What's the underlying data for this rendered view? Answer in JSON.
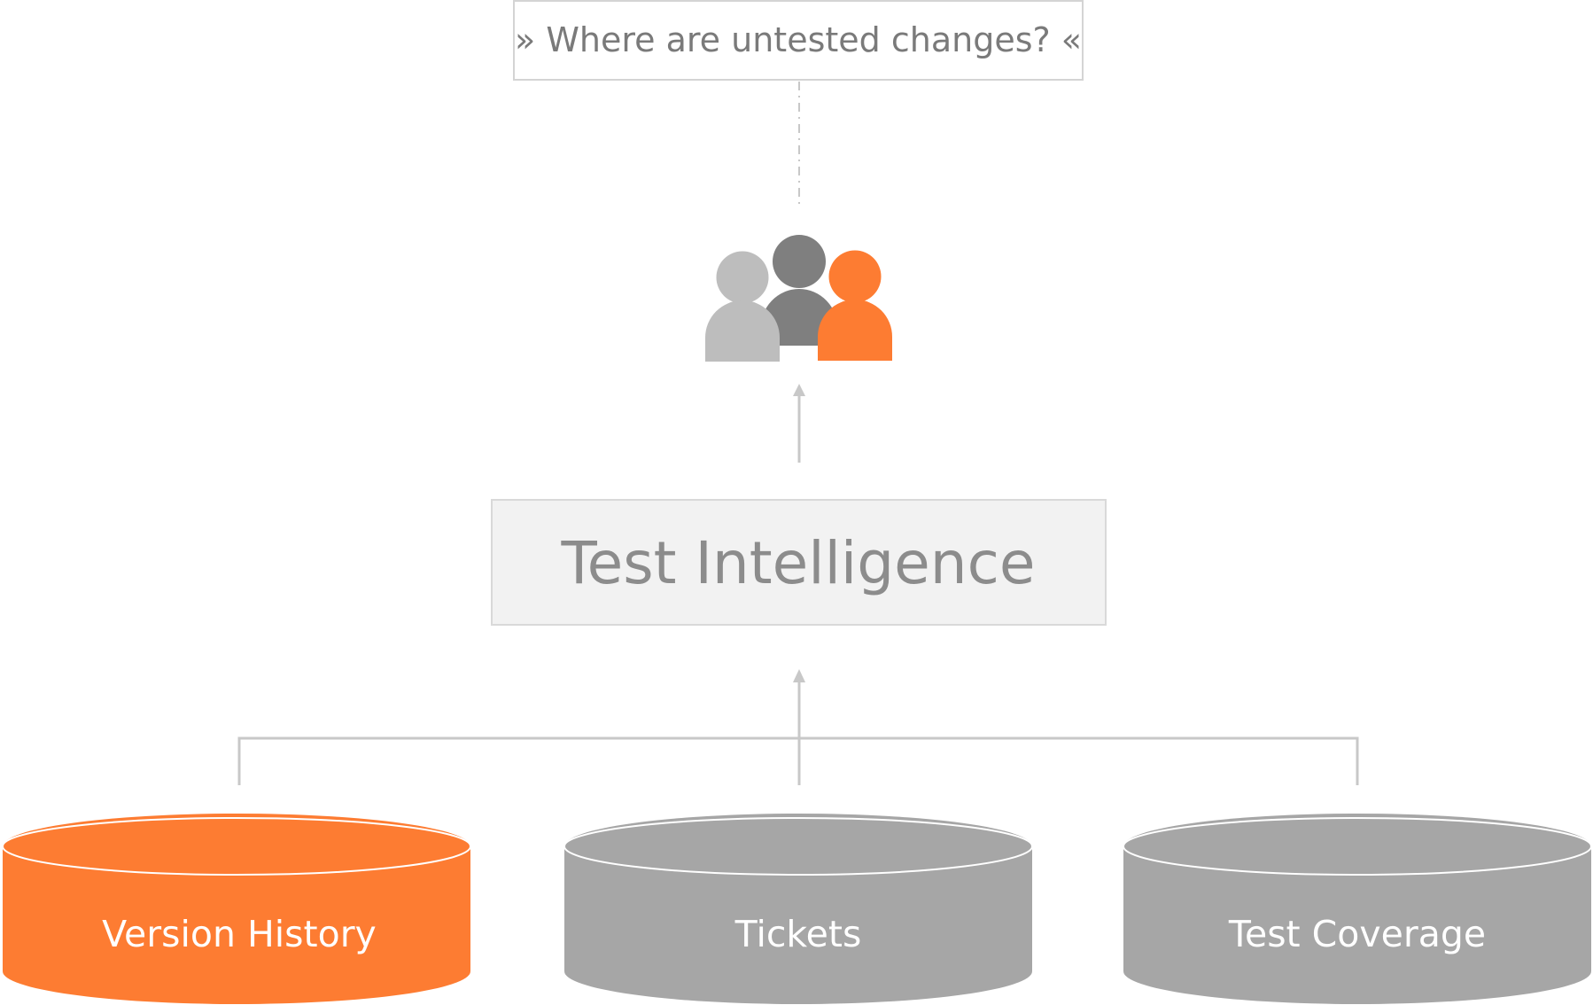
{
  "question": {
    "text": "» Where are untested changes? «"
  },
  "users": {
    "icon": "people-group-icon",
    "colors": [
      "#bdbdbd",
      "#7f7f7f",
      "#fd7c32"
    ]
  },
  "central": {
    "label": "Test Intelligence",
    "fill": "#f2f2f2",
    "border": "#d9d9d9"
  },
  "sources": [
    {
      "label": "Version History",
      "color": "#fd7c32"
    },
    {
      "label": "Tickets",
      "color": "#a6a6a6"
    },
    {
      "label": "Test Coverage",
      "color": "#a6a6a6"
    }
  ],
  "colors": {
    "accent": "#fd7c32",
    "connector": "#c8c8c8"
  }
}
